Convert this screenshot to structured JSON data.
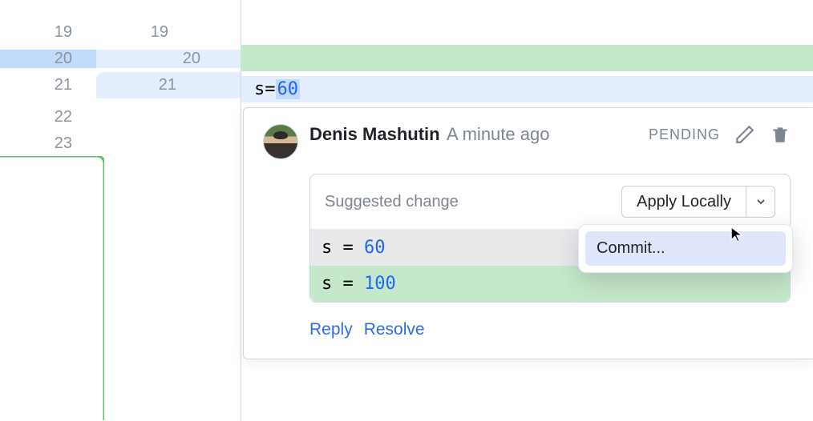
{
  "gutter": {
    "rows_top": [
      {
        "left": "19",
        "right": "19"
      },
      {
        "left": "20",
        "right": "20"
      },
      {
        "left": "21",
        "right": "21"
      }
    ],
    "rows_below": [
      {
        "left": "22"
      },
      {
        "left": "23"
      }
    ]
  },
  "code": {
    "line21": {
      "var": "s",
      "op": " = ",
      "num": "60"
    }
  },
  "comment": {
    "author": "Denis Mashutin",
    "timestamp": "A minute ago",
    "status": "PENDING",
    "suggestion_label": "Suggested change",
    "apply_label": "Apply Locally",
    "diff": {
      "old": {
        "var": "s",
        "op": " = ",
        "num": "60"
      },
      "new": {
        "var": "s",
        "op": " = ",
        "num": "100"
      }
    },
    "dropdown": {
      "items": [
        "Commit..."
      ]
    },
    "actions": {
      "reply": "Reply",
      "resolve": "Resolve"
    }
  },
  "colors": {
    "link": "#2d6ce5",
    "number": "#1e66f5",
    "added_bg": "#c5e8cb",
    "removed_bg": "#e8e9eb"
  }
}
